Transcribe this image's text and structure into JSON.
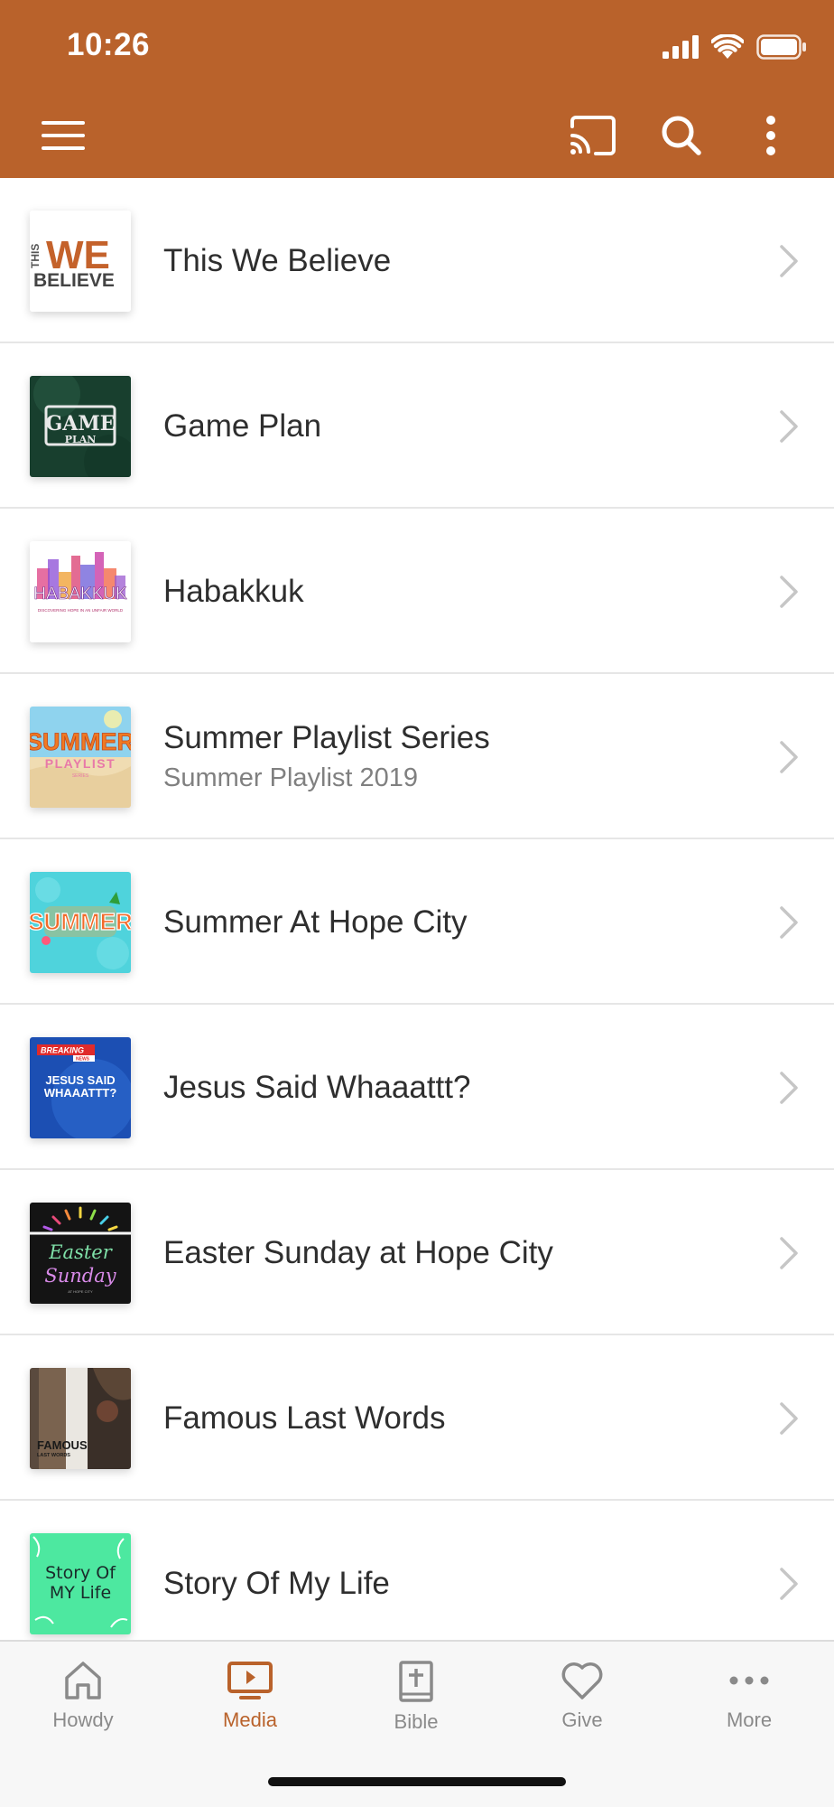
{
  "status_bar": {
    "time": "10:26"
  },
  "header": {
    "accent_color": "#b9622b",
    "icons": [
      "menu-icon",
      "cast-icon",
      "search-icon",
      "more-vertical-icon"
    ]
  },
  "series": [
    {
      "title": "This We Believe",
      "subtitle": "",
      "thumb_text": [
        "THIS",
        "WE",
        "BELIEVE"
      ]
    },
    {
      "title": "Game Plan",
      "subtitle": "",
      "thumb_text": [
        "GAME",
        "PLAN"
      ]
    },
    {
      "title": "Habakkuk",
      "subtitle": "",
      "thumb_text": [
        "HABAKKUK",
        "DISCOVERING HOPE IN AN UNFAIR WORLD"
      ]
    },
    {
      "title": "Summer Playlist Series",
      "subtitle": "Summer Playlist 2019",
      "thumb_text": [
        "SUMMER",
        "PLAYLIST",
        "SERIES"
      ]
    },
    {
      "title": "Summer At Hope City",
      "subtitle": "",
      "thumb_text": [
        "SUMMER"
      ]
    },
    {
      "title": "Jesus Said Whaaattt?",
      "subtitle": "",
      "thumb_text": [
        "BREAKING",
        "NEWS",
        "JESUS SAID",
        "WHAAATTT?"
      ]
    },
    {
      "title": "Easter Sunday at Hope City",
      "subtitle": "",
      "thumb_text": [
        "Easter",
        "Sunday",
        "AT HOPE CITY"
      ]
    },
    {
      "title": "Famous Last Words",
      "subtitle": "",
      "thumb_text": [
        "FAMOUS",
        "LAST WORDS"
      ]
    },
    {
      "title": "Story Of My Life",
      "subtitle": "",
      "thumb_text": [
        "Story Of",
        "MY Life"
      ]
    }
  ],
  "tabbar": {
    "active_color": "#b9622b",
    "inactive_color": "#8a8a8a",
    "tabs": [
      {
        "label": "Howdy",
        "icon": "home-icon"
      },
      {
        "label": "Media",
        "icon": "media-icon"
      },
      {
        "label": "Bible",
        "icon": "bible-icon"
      },
      {
        "label": "Give",
        "icon": "heart-icon"
      },
      {
        "label": "More",
        "icon": "more-horizontal-icon"
      }
    ]
  }
}
